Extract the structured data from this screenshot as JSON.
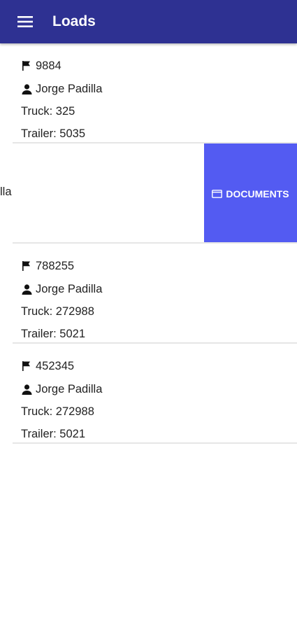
{
  "appbar": {
    "title": "Loads",
    "menu_icon": "hamburger-menu-icon"
  },
  "loads": [
    {
      "id": "9884",
      "driver": "Jorge Padilla",
      "truck": "Truck: 325",
      "trailer": "Trailer: 5035"
    },
    {
      "partial_text": "lla",
      "action_label": "DOCUMENTS",
      "action_icon": "folder-icon",
      "action_color": "#535bf2"
    },
    {
      "id": "788255",
      "driver": "Jorge Padilla",
      "truck": "Truck: 272988",
      "trailer": "Trailer: 5021"
    },
    {
      "id": "452345",
      "driver": "Jorge Padilla",
      "truck": "Truck: 272988",
      "trailer": "Trailer: 5021"
    }
  ],
  "colors": {
    "appbar": "#2e3192",
    "divider": "#e6e6e6"
  }
}
